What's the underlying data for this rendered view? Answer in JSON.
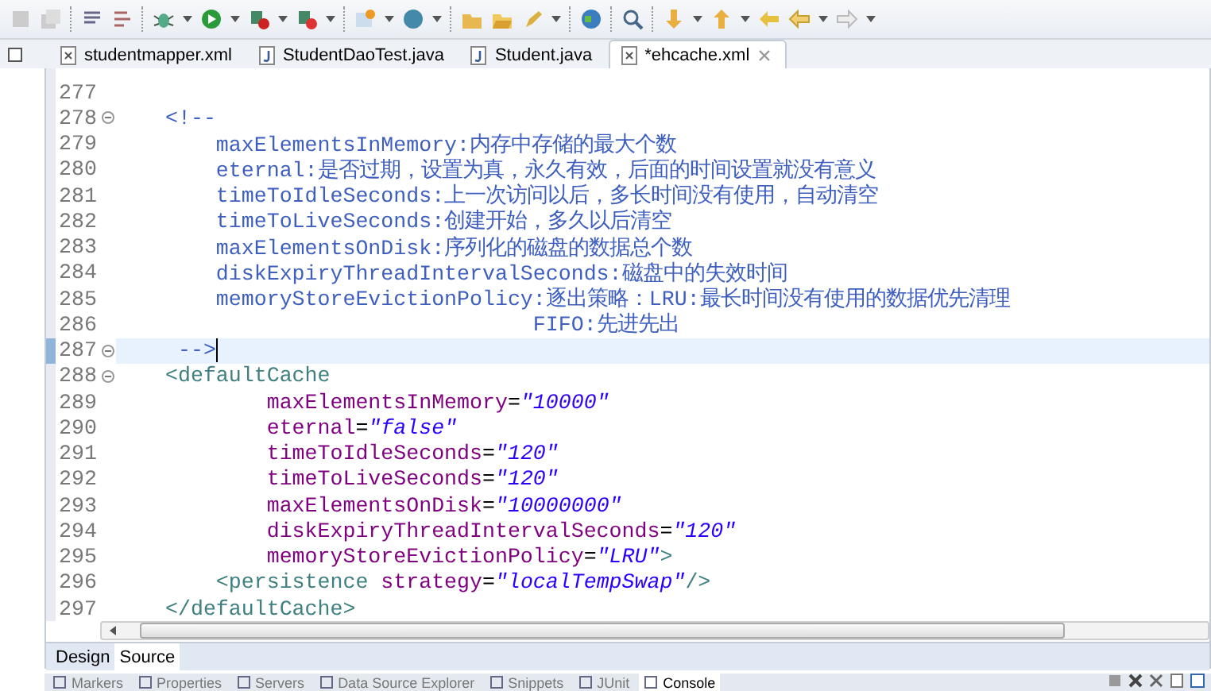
{
  "editor_tabs": [
    {
      "label": "studentmapper.xml",
      "kind": "xml",
      "selected": false
    },
    {
      "label": "StudentDaoTest.java",
      "kind": "java",
      "selected": false
    },
    {
      "label": "Student.java",
      "kind": "java",
      "selected": false
    },
    {
      "label": "*ehcache.xml",
      "kind": "xml",
      "selected": true
    }
  ],
  "code_lines": [
    {
      "number": "277",
      "fold": false,
      "current": false,
      "cursor": false
    },
    {
      "number": "278",
      "fold": true,
      "current": false,
      "cursor": false,
      "tokens": [
        {
          "kind": "comment",
          "text": "<!--"
        }
      ]
    },
    {
      "number": "279",
      "fold": false,
      "current": false,
      "cursor": false,
      "tokens": [
        {
          "kind": "comment",
          "text": "    maxElementsInMemory:内存中存储的最大个数"
        }
      ]
    },
    {
      "number": "280",
      "fold": false,
      "current": false,
      "cursor": false,
      "tokens": [
        {
          "kind": "comment",
          "text": "    eternal:是否过期，设置为真，永久有效，后面的时间设置就没有意义"
        }
      ]
    },
    {
      "number": "281",
      "fold": false,
      "current": false,
      "cursor": false,
      "tokens": [
        {
          "kind": "comment",
          "text": "    timeToIdleSeconds:上一次访问以后，多长时间没有使用，自动清空"
        }
      ]
    },
    {
      "number": "282",
      "fold": false,
      "current": false,
      "cursor": false,
      "tokens": [
        {
          "kind": "comment",
          "text": "    timeToLiveSeconds:创建开始，多久以后清空"
        }
      ]
    },
    {
      "number": "283",
      "fold": false,
      "current": false,
      "cursor": false,
      "tokens": [
        {
          "kind": "comment",
          "text": "    maxElementsOnDisk:序列化的磁盘的数据总个数"
        }
      ]
    },
    {
      "number": "284",
      "fold": false,
      "current": false,
      "cursor": false,
      "tokens": [
        {
          "kind": "comment",
          "text": "    diskExpiryThreadIntervalSeconds:磁盘中的失效时间"
        }
      ]
    },
    {
      "number": "285",
      "fold": false,
      "current": false,
      "cursor": false,
      "tokens": [
        {
          "kind": "comment",
          "text": "    memoryStoreEvictionPolicy:逐出策略：LRU:最长时间没有使用的数据优先清理"
        }
      ]
    },
    {
      "number": "286",
      "fold": false,
      "current": false,
      "cursor": false,
      "tokens": [
        {
          "kind": "comment",
          "text": "                             FIFO:先进先出"
        }
      ]
    },
    {
      "number": "287",
      "fold": true,
      "current": true,
      "cursor": true,
      "tokens": [
        {
          "kind": "comment",
          "text": " -->"
        }
      ]
    },
    {
      "number": "288",
      "fold": true,
      "current": false,
      "cursor": false,
      "tokens": [
        {
          "kind": "tag",
          "text": "<defaultCache"
        }
      ]
    },
    {
      "number": "289",
      "fold": false,
      "current": false,
      "cursor": false,
      "tokens": [
        {
          "kind": "attr",
          "text": "        maxElementsInMemory"
        },
        {
          "kind": "punct",
          "text": "="
        },
        {
          "kind": "value",
          "text": "\"10000\""
        }
      ]
    },
    {
      "number": "290",
      "fold": false,
      "current": false,
      "cursor": false,
      "tokens": [
        {
          "kind": "attr",
          "text": "        eternal"
        },
        {
          "kind": "punct",
          "text": "="
        },
        {
          "kind": "value",
          "text": "\"false\""
        }
      ]
    },
    {
      "number": "291",
      "fold": false,
      "current": false,
      "cursor": false,
      "tokens": [
        {
          "kind": "attr",
          "text": "        timeToIdleSeconds"
        },
        {
          "kind": "punct",
          "text": "="
        },
        {
          "kind": "value",
          "text": "\"120\""
        }
      ]
    },
    {
      "number": "292",
      "fold": false,
      "current": false,
      "cursor": false,
      "tokens": [
        {
          "kind": "attr",
          "text": "        timeToLiveSeconds"
        },
        {
          "kind": "punct",
          "text": "="
        },
        {
          "kind": "value",
          "text": "\"120\""
        }
      ]
    },
    {
      "number": "293",
      "fold": false,
      "current": false,
      "cursor": false,
      "tokens": [
        {
          "kind": "attr",
          "text": "        maxElementsOnDisk"
        },
        {
          "kind": "punct",
          "text": "="
        },
        {
          "kind": "value",
          "text": "\"10000000\""
        }
      ]
    },
    {
      "number": "294",
      "fold": false,
      "current": false,
      "cursor": false,
      "tokens": [
        {
          "kind": "attr",
          "text": "        diskExpiryThreadIntervalSeconds"
        },
        {
          "kind": "punct",
          "text": "="
        },
        {
          "kind": "value",
          "text": "\"120\""
        }
      ]
    },
    {
      "number": "295",
      "fold": false,
      "current": false,
      "cursor": false,
      "tokens": [
        {
          "kind": "attr",
          "text": "        memoryStoreEvictionPolicy"
        },
        {
          "kind": "punct",
          "text": "="
        },
        {
          "kind": "value",
          "text": "\"LRU\""
        },
        {
          "kind": "tag",
          "text": ">"
        }
      ]
    },
    {
      "number": "296",
      "fold": false,
      "current": false,
      "cursor": false,
      "tokens": [
        {
          "kind": "tag",
          "text": "    <persistence"
        },
        {
          "kind": "attr",
          "text": " strategy"
        },
        {
          "kind": "punct",
          "text": "="
        },
        {
          "kind": "value",
          "text": "\"localTempSwap\""
        },
        {
          "kind": "tag",
          "text": "/>"
        }
      ]
    },
    {
      "number": "297",
      "fold": false,
      "current": false,
      "cursor": false,
      "tokens": [
        {
          "kind": "tag",
          "text": "</defaultCache>"
        }
      ]
    }
  ],
  "page_tabs": [
    {
      "label": "Design",
      "selected": false
    },
    {
      "label": "Source",
      "selected": true
    }
  ],
  "view_tabs": [
    {
      "label": "Markers",
      "selected": false
    },
    {
      "label": "Properties",
      "selected": false
    },
    {
      "label": "Servers",
      "selected": false
    },
    {
      "label": "Data Source Explorer",
      "selected": false
    },
    {
      "label": "Snippets",
      "selected": false
    },
    {
      "label": "JUnit",
      "selected": false
    },
    {
      "label": "Console",
      "selected": true
    }
  ]
}
